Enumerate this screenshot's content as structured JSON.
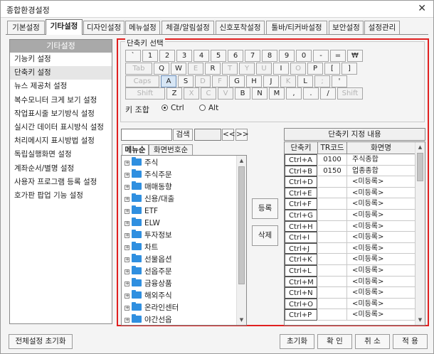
{
  "window": {
    "title": "종합환경설정",
    "close_glyph": "✕"
  },
  "tabs": [
    {
      "label": "기본설정",
      "active": false
    },
    {
      "label": "기타설정",
      "active": true
    },
    {
      "label": "디자인설정",
      "active": false
    },
    {
      "label": "메뉴설정",
      "active": false
    },
    {
      "label": "체결/알림설정",
      "active": false
    },
    {
      "label": "신호포착설정",
      "active": false
    },
    {
      "label": "툴바/티커바설정",
      "active": false
    },
    {
      "label": "보안설정",
      "active": false
    },
    {
      "label": "설정관리",
      "active": false
    }
  ],
  "sidebar": {
    "header": "기타설정",
    "items": [
      {
        "label": "기능키 설정"
      },
      {
        "label": "단축키 설정",
        "selected": true
      },
      {
        "label": "뉴스 제공처 설정"
      },
      {
        "label": "복수모니터 크게 보기 설정"
      },
      {
        "label": "작업표시줄 보기방식 설정"
      },
      {
        "label": "실시간 데이터 표시방식 설정"
      },
      {
        "label": "처리메시지 표시방법 설정"
      },
      {
        "label": "독립실행화면 설정"
      },
      {
        "label": "계좌순서/별명 설정"
      },
      {
        "label": "사용자 프로그램 등록 설정"
      },
      {
        "label": "호가판 팝업 기능 설정"
      }
    ]
  },
  "shortcut_select": {
    "group_title": "단축키 선택",
    "keyboard": {
      "row1": [
        "`",
        "1",
        "2",
        "3",
        "4",
        "5",
        "6",
        "7",
        "8",
        "9",
        "0",
        "-",
        "=",
        "₩"
      ],
      "row2": [
        "Tab",
        "Q",
        "W",
        "E",
        "R",
        "T",
        "Y",
        "U",
        "I",
        "O",
        "P",
        "[",
        "]"
      ],
      "row3": [
        "Caps",
        "A",
        "S",
        "D",
        "F",
        "G",
        "H",
        "J",
        "K",
        "L",
        ";",
        "'"
      ],
      "row4": [
        "Shift",
        "Z",
        "X",
        "C",
        "V",
        "B",
        "N",
        "M",
        ",",
        ".",
        "/",
        "Shift"
      ],
      "selected_key": "A"
    },
    "combo_label": "키 조합",
    "ctrl_label": "Ctrl",
    "alt_label": "Alt",
    "ctrl_checked": true
  },
  "search": {
    "value": "",
    "button": "검색",
    "prev": "<<",
    "next": ">>"
  },
  "menu_tabs": [
    {
      "label": "메뉴순",
      "active": true
    },
    {
      "label": "화면번호순",
      "active": false
    }
  ],
  "tree": {
    "items": [
      "주식",
      "주식주문",
      "매매동향",
      "신용/대출",
      "ETF",
      "ELW",
      "투자정보",
      "차트",
      "선물옵션",
      "선옵주문",
      "금융상품",
      "해외주식",
      "온라인센터",
      "야간선옵"
    ],
    "expand_glyph": "+",
    "scroll_up": "▲",
    "scroll_down": "▼"
  },
  "actions": {
    "register": "등록",
    "delete": "삭제"
  },
  "shortcut_table": {
    "title": "단축키 지정 내용",
    "headers": [
      "단축키",
      "TR코드",
      "화면명"
    ],
    "rows": [
      [
        "Ctrl+A",
        "0100",
        "주식종합"
      ],
      [
        "Ctrl+B",
        "0150",
        "업종종합"
      ],
      [
        "Ctrl+D",
        "",
        "<미등록>"
      ],
      [
        "Ctrl+E",
        "",
        "<미등록>"
      ],
      [
        "Ctrl+F",
        "",
        "<미등록>"
      ],
      [
        "Ctrl+G",
        "",
        "<미등록>"
      ],
      [
        "Ctrl+H",
        "",
        "<미등록>"
      ],
      [
        "Ctrl+I",
        "",
        "<미등록>"
      ],
      [
        "Ctrl+J",
        "",
        "<미등록>"
      ],
      [
        "Ctrl+K",
        "",
        "<미등록>"
      ],
      [
        "Ctrl+L",
        "",
        "<미등록>"
      ],
      [
        "Ctrl+M",
        "",
        "<미등록>"
      ],
      [
        "Ctrl+N",
        "",
        "<미등록>"
      ],
      [
        "Ctrl+O",
        "",
        "<미등록>"
      ],
      [
        "Ctrl+P",
        "",
        "<미등록>"
      ]
    ]
  },
  "footer": {
    "reset_all": "전체설정 초기화",
    "reset": "초기화",
    "ok": "확 인",
    "cancel": "취 소",
    "apply": "적 용"
  },
  "colors": {
    "highlight_border": "#e02020",
    "folder": "#2f8fe0"
  }
}
